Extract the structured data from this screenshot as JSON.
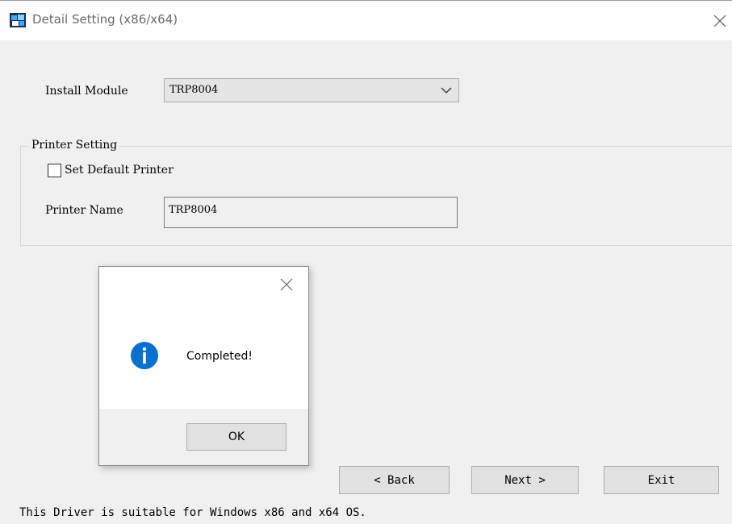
{
  "window": {
    "title": "Detail Setting (x86/x64)",
    "icon": "app-installer-icon"
  },
  "install_module": {
    "label": "Install Module",
    "selected": "TRP8004"
  },
  "printer_setting": {
    "group_title": "Printer Setting",
    "set_default_label": "Set Default Printer",
    "set_default_checked": false,
    "printer_name_label": "Printer Name",
    "printer_name_value": "TRP8004"
  },
  "buttons": {
    "back": "< Back",
    "next": "Next >",
    "exit": "Exit"
  },
  "footer_text": "This Driver is suitable for Windows x86 and x64 OS.",
  "dialog": {
    "message": "Completed!",
    "ok": "OK",
    "icon": "info-icon",
    "accent": "#0a6fd0"
  }
}
